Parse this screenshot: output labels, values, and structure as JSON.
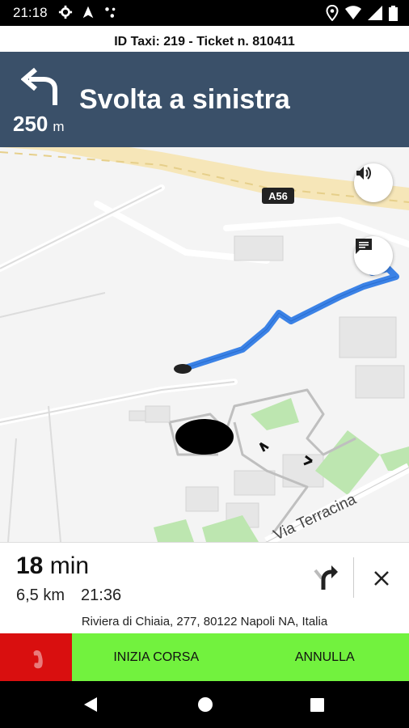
{
  "status_bar": {
    "time": "21:18",
    "icons": [
      "gear-icon",
      "navigation-arrow-icon",
      "dots-icon",
      "location-icon",
      "wifi-icon",
      "signal-icon",
      "battery-icon"
    ]
  },
  "ticket": {
    "text": "ID Taxi: 219 - Ticket n. 810411"
  },
  "navigation": {
    "distance": "250",
    "distance_unit": "m",
    "instruction": "Svolta a sinistra",
    "header_color": "#3a5069"
  },
  "map": {
    "highway_label": "A56",
    "street_label": "Via Terracina",
    "route_color": "#3b82e6"
  },
  "route": {
    "minutes": "18",
    "minutes_unit": "min",
    "distance": "6,5 km",
    "arrival_time": "21:36"
  },
  "address": "Riviera di Chiaia, 277, 80122 Napoli NA, Italia",
  "actions": {
    "start_label": "INIZIA CORSA",
    "cancel_label": "ANNULLA",
    "call_color": "#d90f0f",
    "action_color": "#72f23e"
  }
}
